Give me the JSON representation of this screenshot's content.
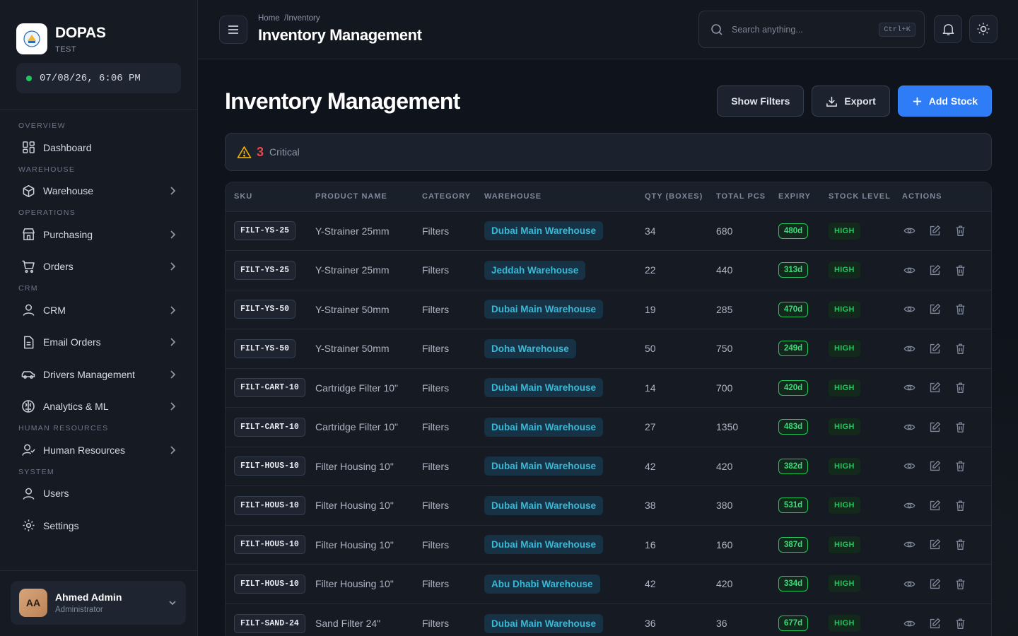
{
  "brand": {
    "name": "DOPAS",
    "sub": "TEST"
  },
  "clock": "07/08/26, 6:06 PM",
  "nav": {
    "overview": "OVERVIEW",
    "dashboard": "Dashboard",
    "warehouse_section": "WAREHOUSE",
    "warehouse": "Warehouse",
    "operations": "OPERATIONS",
    "purchasing": "Purchasing",
    "orders": "Orders",
    "crm_section": "CRM",
    "crm": "CRM",
    "email_orders": "Email Orders",
    "drivers": "Drivers Management",
    "analytics": "Analytics & ML",
    "hr_section": "HUMAN RESOURCES",
    "hr": "Human Resources",
    "system": "SYSTEM",
    "users": "Users",
    "settings": "Settings"
  },
  "user": {
    "initials": "AA",
    "name": "Ahmed Admin",
    "role": "Administrator"
  },
  "header": {
    "breadcrumb": "Home  /Inventory",
    "title": "Inventory Management"
  },
  "search": {
    "placeholder": "Search anything...",
    "shortcut": "Ctrl+K"
  },
  "page": {
    "title": "Inventory Management",
    "show_filters": "Show Filters",
    "export": "Export",
    "add_stock": "Add Stock"
  },
  "alert": {
    "count": "3",
    "label": "Critical"
  },
  "table": {
    "headers": [
      "SKU",
      "PRODUCT NAME",
      "CATEGORY",
      "WAREHOUSE",
      "QTY (BOXES)",
      "TOTAL PCS",
      "EXPIRY",
      "STOCK LEVEL",
      "ACTIONS"
    ],
    "rows": [
      {
        "sku": "FILT-YS-25",
        "product": "Y-Strainer 25mm",
        "category": "Filters",
        "warehouse": "Dubai Main Warehouse",
        "qty": "34",
        "pcs": "680",
        "expiry": "480d",
        "level": "HIGH"
      },
      {
        "sku": "FILT-YS-25",
        "product": "Y-Strainer 25mm",
        "category": "Filters",
        "warehouse": "Jeddah Warehouse",
        "qty": "22",
        "pcs": "440",
        "expiry": "313d",
        "level": "HIGH"
      },
      {
        "sku": "FILT-YS-50",
        "product": "Y-Strainer 50mm",
        "category": "Filters",
        "warehouse": "Dubai Main Warehouse",
        "qty": "19",
        "pcs": "285",
        "expiry": "470d",
        "level": "HIGH"
      },
      {
        "sku": "FILT-YS-50",
        "product": "Y-Strainer 50mm",
        "category": "Filters",
        "warehouse": "Doha Warehouse",
        "qty": "50",
        "pcs": "750",
        "expiry": "249d",
        "level": "HIGH"
      },
      {
        "sku": "FILT-CART-10",
        "product": "Cartridge Filter 10\"",
        "category": "Filters",
        "warehouse": "Dubai Main Warehouse",
        "qty": "14",
        "pcs": "700",
        "expiry": "420d",
        "level": "HIGH"
      },
      {
        "sku": "FILT-CART-10",
        "product": "Cartridge Filter 10\"",
        "category": "Filters",
        "warehouse": "Dubai Main Warehouse",
        "qty": "27",
        "pcs": "1350",
        "expiry": "483d",
        "level": "HIGH"
      },
      {
        "sku": "FILT-HOUS-10",
        "product": "Filter Housing 10\"",
        "category": "Filters",
        "warehouse": "Dubai Main Warehouse",
        "qty": "42",
        "pcs": "420",
        "expiry": "382d",
        "level": "HIGH"
      },
      {
        "sku": "FILT-HOUS-10",
        "product": "Filter Housing 10\"",
        "category": "Filters",
        "warehouse": "Dubai Main Warehouse",
        "qty": "38",
        "pcs": "380",
        "expiry": "531d",
        "level": "HIGH"
      },
      {
        "sku": "FILT-HOUS-10",
        "product": "Filter Housing 10\"",
        "category": "Filters",
        "warehouse": "Dubai Main Warehouse",
        "qty": "16",
        "pcs": "160",
        "expiry": "387d",
        "level": "HIGH"
      },
      {
        "sku": "FILT-HOUS-10",
        "product": "Filter Housing 10\"",
        "category": "Filters",
        "warehouse": "Abu Dhabi Warehouse",
        "qty": "42",
        "pcs": "420",
        "expiry": "334d",
        "level": "HIGH"
      },
      {
        "sku": "FILT-SAND-24",
        "product": "Sand Filter 24\"",
        "category": "Filters",
        "warehouse": "Dubai Main Warehouse",
        "qty": "36",
        "pcs": "36",
        "expiry": "677d",
        "level": "HIGH"
      }
    ]
  },
  "colors": {
    "accent": "#2f7df6",
    "success": "#22c55e",
    "danger": "#ef4444",
    "warning": "#f5b400",
    "warehouse_tag": "#3ab8d6"
  }
}
